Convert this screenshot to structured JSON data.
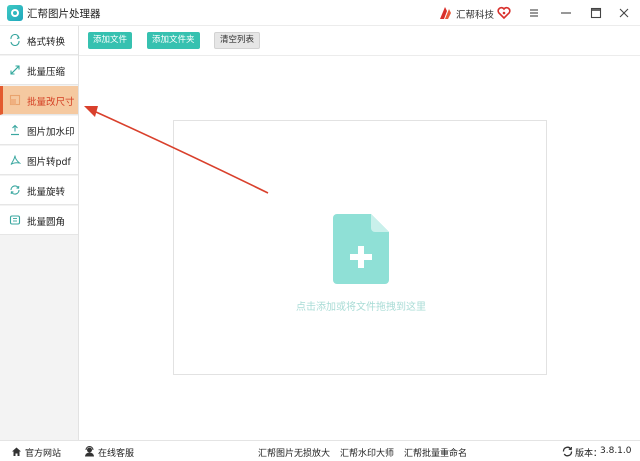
{
  "window": {
    "title": "汇帮图片处理器",
    "brand_name": "汇帮科技",
    "app_icon": "app-logo-icon",
    "brand_icon": "huibang-logo-icon",
    "controls": [
      "menu-icon",
      "minimize-icon",
      "maximize-icon",
      "close-icon"
    ]
  },
  "sidebar": {
    "items": [
      {
        "label": "格式转换",
        "icon": "format-convert-icon",
        "active": false
      },
      {
        "label": "批量压缩",
        "icon": "compress-icon",
        "active": false
      },
      {
        "label": "批量改尺寸",
        "icon": "resize-icon",
        "active": true
      },
      {
        "label": "图片加水印",
        "icon": "watermark-icon",
        "active": false
      },
      {
        "label": "图片转pdf",
        "icon": "pdf-icon",
        "active": false
      },
      {
        "label": "批量旋转",
        "icon": "rotate-icon",
        "active": false
      },
      {
        "label": "批量圆角",
        "icon": "round-corner-icon",
        "active": false
      }
    ]
  },
  "toolbar": {
    "add_file": "添加文件",
    "add_folder": "添加文件夹",
    "clear_list": "清空列表"
  },
  "dropzone": {
    "hint": "点击添加或将文件拖拽到这里",
    "icon": "file-add-icon"
  },
  "footer": {
    "website": "官方网站",
    "support": "在线客服",
    "link1": "汇帮图片无损放大",
    "link2": "汇帮水印大师",
    "link3": "汇帮批量重命名",
    "version_label": "版本：",
    "version": "3.8.1.0"
  },
  "colors": {
    "accent_green": "#36c1b0",
    "active_bg": "#f5c9a0",
    "active_text": "#d43f23",
    "annotation_arrow": "#d9402c",
    "file_icon": "#8fe0d6"
  }
}
